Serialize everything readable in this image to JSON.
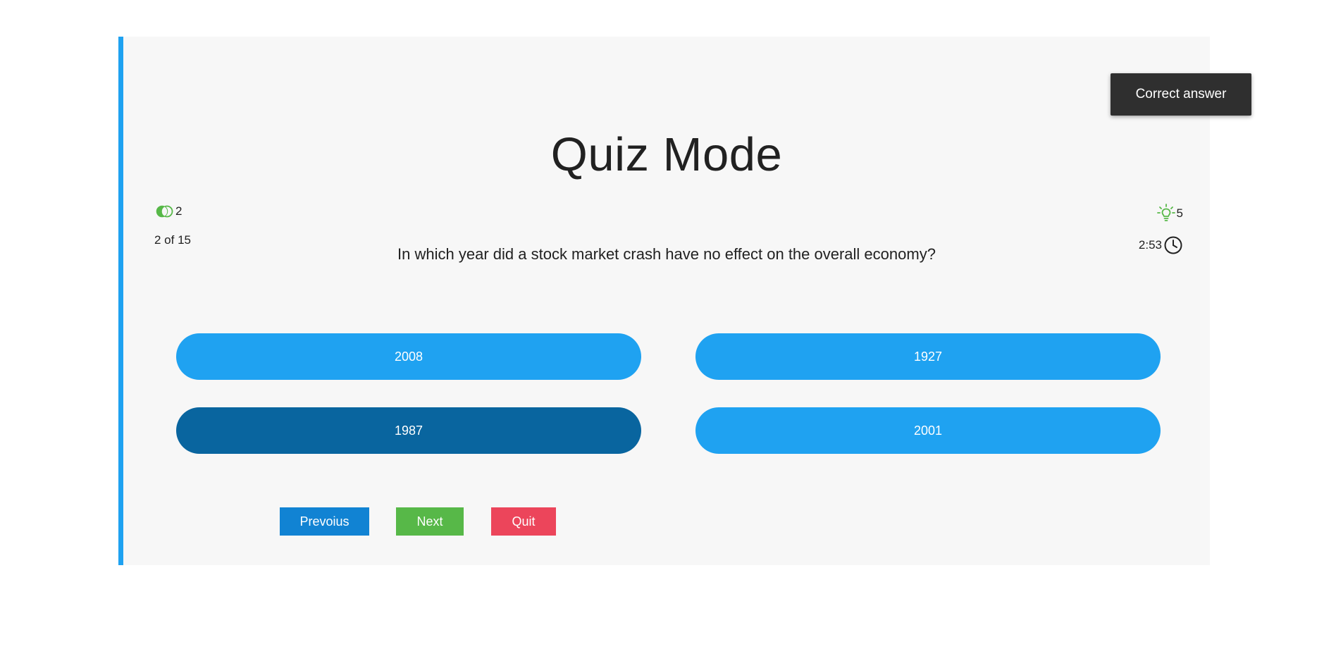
{
  "quiz": {
    "title": "Quiz Mode",
    "score": "2",
    "progress": "2 of 15",
    "hints": "5",
    "timer": "2:53",
    "question": "In which year did a stock market crash have no effect on the overall economy?",
    "answers": [
      {
        "label": "2008",
        "selected": false
      },
      {
        "label": "1927",
        "selected": false
      },
      {
        "label": "1987",
        "selected": true
      },
      {
        "label": "2001",
        "selected": false
      }
    ]
  },
  "navigation": {
    "previous_label": "Prevoius",
    "next_label": "Next",
    "quit_label": "Quit"
  },
  "toast": {
    "message": "Correct answer"
  },
  "colors": {
    "accent": "#1fa2f1",
    "answer_selected": "#09659f",
    "previous": "#1183d3",
    "next": "#57b848",
    "quit": "#ec455b",
    "score_icon": "#57b848",
    "hint_icon": "#57b848",
    "toast_bg": "#2f2f2f"
  },
  "icons": {
    "score": "score-rings-icon",
    "hints": "lightbulb-icon",
    "timer": "clock-icon"
  }
}
